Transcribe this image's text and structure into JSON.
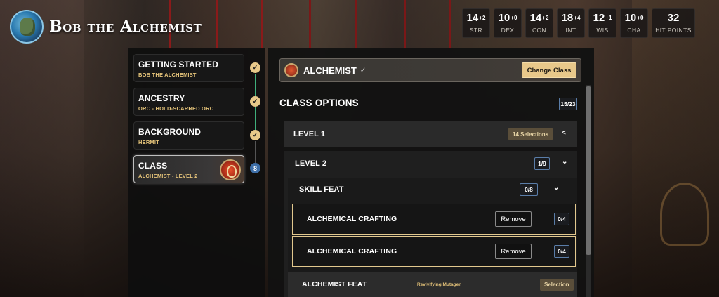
{
  "header": {
    "character_name": "Bob the Alchemist",
    "stats": [
      {
        "value": "14",
        "mod": "+2",
        "label": "STR"
      },
      {
        "value": "10",
        "mod": "+0",
        "label": "DEX"
      },
      {
        "value": "14",
        "mod": "+2",
        "label": "CON"
      },
      {
        "value": "18",
        "mod": "+4",
        "label": "INT"
      },
      {
        "value": "12",
        "mod": "+1",
        "label": "WIS"
      },
      {
        "value": "10",
        "mod": "+0",
        "label": "CHA"
      }
    ],
    "hit_points": {
      "value": "32",
      "label": "HIT POINTS"
    }
  },
  "nav": {
    "steps": [
      {
        "title": "GETTING STARTED",
        "subtitle": "BOB THE ALCHEMIST",
        "status": "complete"
      },
      {
        "title": "ANCESTRY",
        "subtitle": "ORC - HOLD-SCARRED ORC",
        "status": "complete"
      },
      {
        "title": "BACKGROUND",
        "subtitle": "HERMIT",
        "status": "complete"
      },
      {
        "title": "CLASS",
        "subtitle": "ALCHEMIST - LEVEL 2",
        "status": "active",
        "badge": "8"
      }
    ]
  },
  "main": {
    "class_name": "ALCHEMIST",
    "class_check": "✓",
    "change_class_label": "Change Class",
    "section_title": "CLASS OPTIONS",
    "section_count": "15/23",
    "level1": {
      "label": "LEVEL 1",
      "selections": "14 Selections"
    },
    "level2": {
      "label": "LEVEL 2",
      "count": "1/9"
    },
    "skill_feat": {
      "label": "SKILL FEAT",
      "count": "0/8"
    },
    "feats": [
      {
        "name": "ALCHEMICAL CRAFTING",
        "remove_label": "Remove",
        "count": "0/4"
      },
      {
        "name": "ALCHEMICAL CRAFTING",
        "remove_label": "Remove",
        "count": "0/4"
      }
    ],
    "alchemist_feat": {
      "label": "ALCHEMIST FEAT",
      "note": "Revivifying Mutagen",
      "selection_label": "Selection"
    }
  }
}
